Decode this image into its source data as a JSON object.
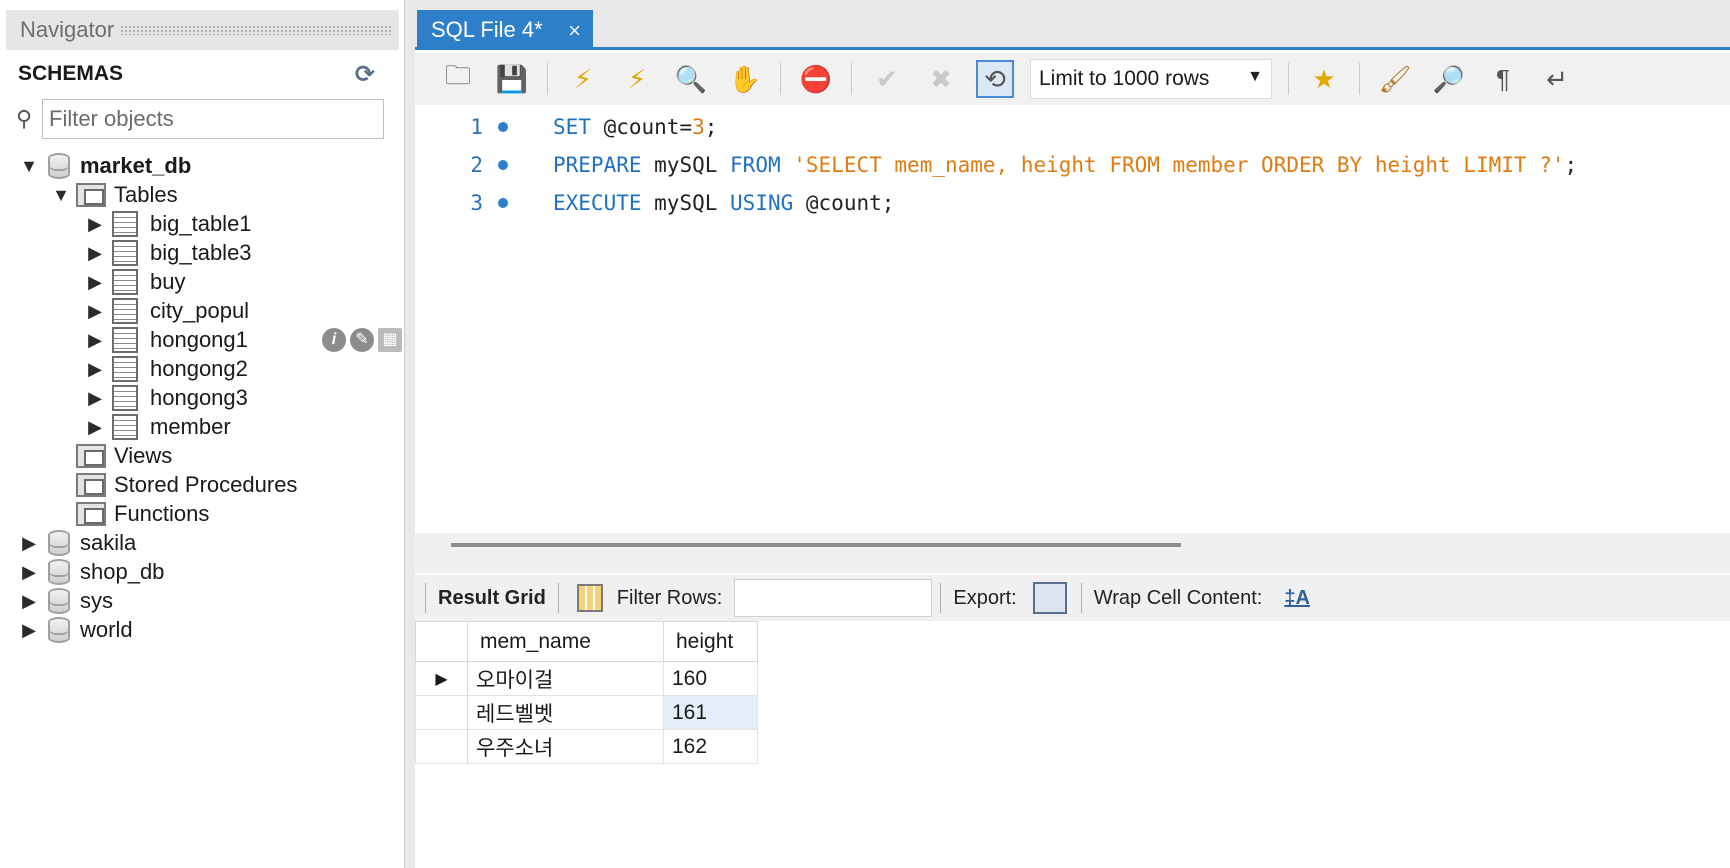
{
  "navigator": {
    "title": "Navigator",
    "schemas_label": "SCHEMAS",
    "filter_placeholder": "Filter objects",
    "databases": [
      {
        "name": "market_db",
        "expanded": true
      },
      {
        "name": "sakila"
      },
      {
        "name": "shop_db"
      },
      {
        "name": "sys"
      },
      {
        "name": "world"
      }
    ],
    "tables_label": "Tables",
    "tables": [
      "big_table1",
      "big_table3",
      "buy",
      "city_popul",
      "hongong1",
      "hongong2",
      "hongong3",
      "member"
    ],
    "views_label": "Views",
    "procedures_label": "Stored Procedures",
    "functions_label": "Functions"
  },
  "editor": {
    "tab_title": "SQL File 4*",
    "limit_label": "Limit to 1000 rows",
    "lines": [
      {
        "num": "1",
        "parts": [
          [
            "kw",
            "SET"
          ],
          [
            "plain",
            " @count="
          ],
          [
            "num",
            "3"
          ],
          [
            "plain",
            ";"
          ]
        ]
      },
      {
        "num": "2",
        "parts": [
          [
            "kw",
            "PREPARE"
          ],
          [
            "plain",
            " mySQL "
          ],
          [
            "kw",
            "FROM"
          ],
          [
            "plain",
            " "
          ],
          [
            "str",
            "'SELECT mem_name, height FROM member ORDER BY height LIMIT ?'"
          ],
          [
            "plain",
            ";"
          ]
        ]
      },
      {
        "num": "3",
        "parts": [
          [
            "kw",
            "EXECUTE"
          ],
          [
            "plain",
            " mySQL "
          ],
          [
            "kw",
            "USING"
          ],
          [
            "plain",
            " @count;"
          ]
        ]
      }
    ]
  },
  "results": {
    "result_grid_label": "Result Grid",
    "filter_rows_label": "Filter Rows:",
    "export_label": "Export:",
    "wrap_label": "Wrap Cell Content:",
    "columns": [
      "mem_name",
      "height"
    ],
    "rows": [
      {
        "mem_name": "오마이걸",
        "height": "160"
      },
      {
        "mem_name": "레드벨벳",
        "height": "161"
      },
      {
        "mem_name": "우주소녀",
        "height": "162"
      }
    ]
  }
}
